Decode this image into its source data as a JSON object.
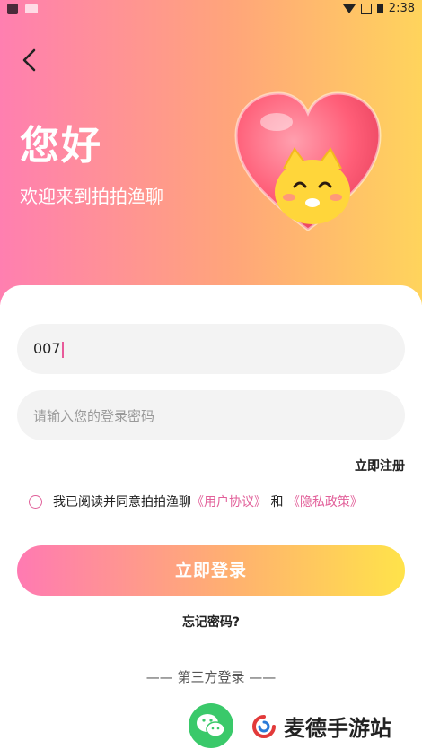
{
  "status_bar": {
    "time": "2:38",
    "icons": [
      "app-icon",
      "wifi-icon",
      "signal-icon",
      "battery-icon"
    ]
  },
  "header": {
    "greeting": "您好",
    "welcome": "欢迎来到拍拍渔聊",
    "mascot": "heart-cat-mascot"
  },
  "form": {
    "account_value": "007",
    "password_placeholder": "请输入您的登录密码",
    "register_link": "立即注册",
    "agreement": {
      "prefix": "我已阅读并同意拍拍渔聊",
      "user_agreement": "《用户协议》",
      "conjunction": " 和 ",
      "privacy_policy": "《隐私政策》"
    },
    "login_button": "立即登录",
    "forgot_password": "忘记密码?"
  },
  "third_party": {
    "title": "—— 第三方登录 ——",
    "providers": [
      "wechat-icon"
    ]
  },
  "watermark": {
    "text": "麦德手游站"
  },
  "colors": {
    "gradient_start": "#ff7fb0",
    "gradient_mid": "#ffa57a",
    "gradient_end": "#ffd45c",
    "link": "#e2609a",
    "wechat": "#3ac96a"
  }
}
